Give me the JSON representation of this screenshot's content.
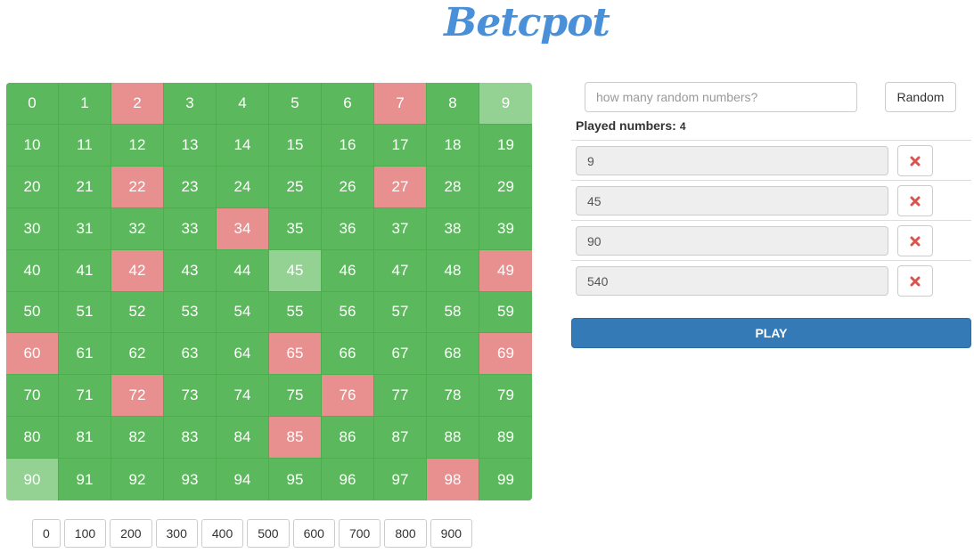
{
  "logo": "Betcpot",
  "grid": {
    "cells": [
      {
        "label": "0",
        "state": "green"
      },
      {
        "label": "1",
        "state": "green"
      },
      {
        "label": "2",
        "state": "red"
      },
      {
        "label": "3",
        "state": "green"
      },
      {
        "label": "4",
        "state": "green"
      },
      {
        "label": "5",
        "state": "green"
      },
      {
        "label": "6",
        "state": "green"
      },
      {
        "label": "7",
        "state": "red"
      },
      {
        "label": "8",
        "state": "green"
      },
      {
        "label": "9",
        "state": "selected"
      },
      {
        "label": "10",
        "state": "green"
      },
      {
        "label": "11",
        "state": "green"
      },
      {
        "label": "12",
        "state": "green"
      },
      {
        "label": "13",
        "state": "green"
      },
      {
        "label": "14",
        "state": "green"
      },
      {
        "label": "15",
        "state": "green"
      },
      {
        "label": "16",
        "state": "green"
      },
      {
        "label": "17",
        "state": "green"
      },
      {
        "label": "18",
        "state": "green"
      },
      {
        "label": "19",
        "state": "green"
      },
      {
        "label": "20",
        "state": "green"
      },
      {
        "label": "21",
        "state": "green"
      },
      {
        "label": "22",
        "state": "red"
      },
      {
        "label": "23",
        "state": "green"
      },
      {
        "label": "24",
        "state": "green"
      },
      {
        "label": "25",
        "state": "green"
      },
      {
        "label": "26",
        "state": "green"
      },
      {
        "label": "27",
        "state": "red"
      },
      {
        "label": "28",
        "state": "green"
      },
      {
        "label": "29",
        "state": "green"
      },
      {
        "label": "30",
        "state": "green"
      },
      {
        "label": "31",
        "state": "green"
      },
      {
        "label": "32",
        "state": "green"
      },
      {
        "label": "33",
        "state": "green"
      },
      {
        "label": "34",
        "state": "red"
      },
      {
        "label": "35",
        "state": "green"
      },
      {
        "label": "36",
        "state": "green"
      },
      {
        "label": "37",
        "state": "green"
      },
      {
        "label": "38",
        "state": "green"
      },
      {
        "label": "39",
        "state": "green"
      },
      {
        "label": "40",
        "state": "green"
      },
      {
        "label": "41",
        "state": "green"
      },
      {
        "label": "42",
        "state": "red"
      },
      {
        "label": "43",
        "state": "green"
      },
      {
        "label": "44",
        "state": "green"
      },
      {
        "label": "45",
        "state": "selected"
      },
      {
        "label": "46",
        "state": "green"
      },
      {
        "label": "47",
        "state": "green"
      },
      {
        "label": "48",
        "state": "green"
      },
      {
        "label": "49",
        "state": "red"
      },
      {
        "label": "50",
        "state": "green"
      },
      {
        "label": "51",
        "state": "green"
      },
      {
        "label": "52",
        "state": "green"
      },
      {
        "label": "53",
        "state": "green"
      },
      {
        "label": "54",
        "state": "green"
      },
      {
        "label": "55",
        "state": "green"
      },
      {
        "label": "56",
        "state": "green"
      },
      {
        "label": "57",
        "state": "green"
      },
      {
        "label": "58",
        "state": "green"
      },
      {
        "label": "59",
        "state": "green"
      },
      {
        "label": "60",
        "state": "red"
      },
      {
        "label": "61",
        "state": "green"
      },
      {
        "label": "62",
        "state": "green"
      },
      {
        "label": "63",
        "state": "green"
      },
      {
        "label": "64",
        "state": "green"
      },
      {
        "label": "65",
        "state": "red"
      },
      {
        "label": "66",
        "state": "green"
      },
      {
        "label": "67",
        "state": "green"
      },
      {
        "label": "68",
        "state": "green"
      },
      {
        "label": "69",
        "state": "red"
      },
      {
        "label": "70",
        "state": "green"
      },
      {
        "label": "71",
        "state": "green"
      },
      {
        "label": "72",
        "state": "red"
      },
      {
        "label": "73",
        "state": "green"
      },
      {
        "label": "74",
        "state": "green"
      },
      {
        "label": "75",
        "state": "green"
      },
      {
        "label": "76",
        "state": "red"
      },
      {
        "label": "77",
        "state": "green"
      },
      {
        "label": "78",
        "state": "green"
      },
      {
        "label": "79",
        "state": "green"
      },
      {
        "label": "80",
        "state": "green"
      },
      {
        "label": "81",
        "state": "green"
      },
      {
        "label": "82",
        "state": "green"
      },
      {
        "label": "83",
        "state": "green"
      },
      {
        "label": "84",
        "state": "green"
      },
      {
        "label": "85",
        "state": "red"
      },
      {
        "label": "86",
        "state": "green"
      },
      {
        "label": "87",
        "state": "green"
      },
      {
        "label": "88",
        "state": "green"
      },
      {
        "label": "89",
        "state": "green"
      },
      {
        "label": "90",
        "state": "selected"
      },
      {
        "label": "91",
        "state": "green"
      },
      {
        "label": "92",
        "state": "green"
      },
      {
        "label": "93",
        "state": "green"
      },
      {
        "label": "94",
        "state": "green"
      },
      {
        "label": "95",
        "state": "green"
      },
      {
        "label": "96",
        "state": "green"
      },
      {
        "label": "97",
        "state": "green"
      },
      {
        "label": "98",
        "state": "red"
      },
      {
        "label": "99",
        "state": "green"
      }
    ]
  },
  "range_buttons": [
    "0",
    "100",
    "200",
    "300",
    "400",
    "500",
    "600",
    "700",
    "800",
    "900"
  ],
  "random": {
    "placeholder": "how many random numbers?",
    "value": "",
    "button_label": "Random"
  },
  "played": {
    "label": "Played numbers:",
    "count": "4",
    "items": [
      "9",
      "45",
      "90",
      "540"
    ],
    "remove_icon": "times-icon"
  },
  "play_button_label": "PLAY",
  "colors": {
    "green": "#5cb85c",
    "red": "#e89090",
    "selected": "#93d293",
    "primary": "#337ab7",
    "danger": "#d9534f",
    "logo": "#4a90d9"
  }
}
